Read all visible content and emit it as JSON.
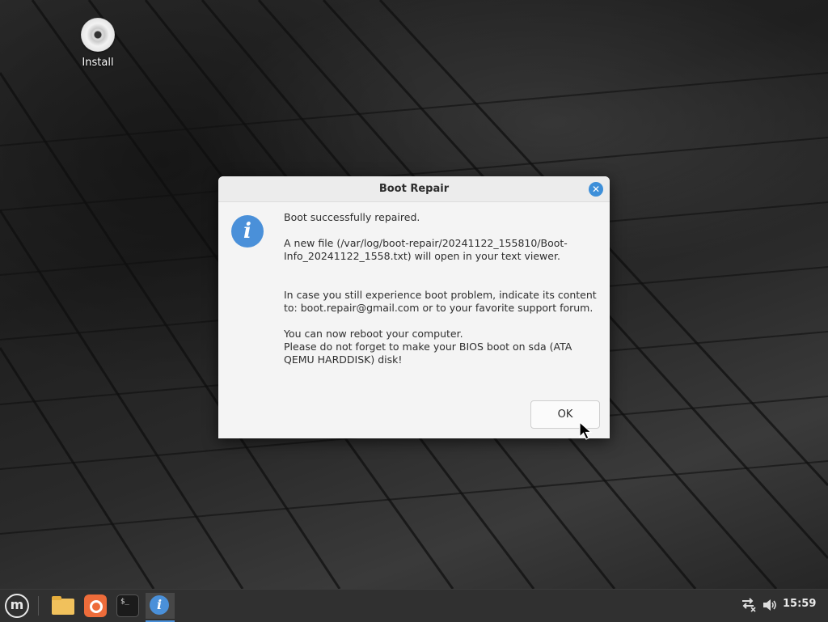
{
  "desktop": {
    "icons": [
      {
        "label": "Install",
        "icon": "disc-icon"
      }
    ]
  },
  "dialog": {
    "title": "Boot Repair",
    "icon": "info-icon",
    "messages": {
      "line1": "Boot successfully repaired.",
      "line2": "A new file (/var/log/boot-repair/20241122_155810/Boot-Info_20241122_1558.txt) will open in your text viewer.",
      "line3": "In case you still experience boot problem, indicate its content to: boot.repair@gmail.com or to your favorite support forum.",
      "line4": "You can now reboot your computer.",
      "line5": "Please do not forget to make your BIOS boot on sda (ATA QEMU HARDDISK) disk!"
    },
    "ok_label": "OK",
    "colors": {
      "accent": "#4a90d9"
    }
  },
  "taskbar": {
    "items": [
      {
        "name": "mint-menu-icon"
      },
      {
        "name": "folder-icon"
      },
      {
        "name": "backup-icon"
      },
      {
        "name": "terminal-icon",
        "glyph": "$_"
      },
      {
        "name": "info-icon",
        "active": true
      }
    ],
    "tray": {
      "network_icon": "network-disconnected-icon",
      "volume_icon": "volume-icon",
      "clock": "15:59"
    }
  }
}
